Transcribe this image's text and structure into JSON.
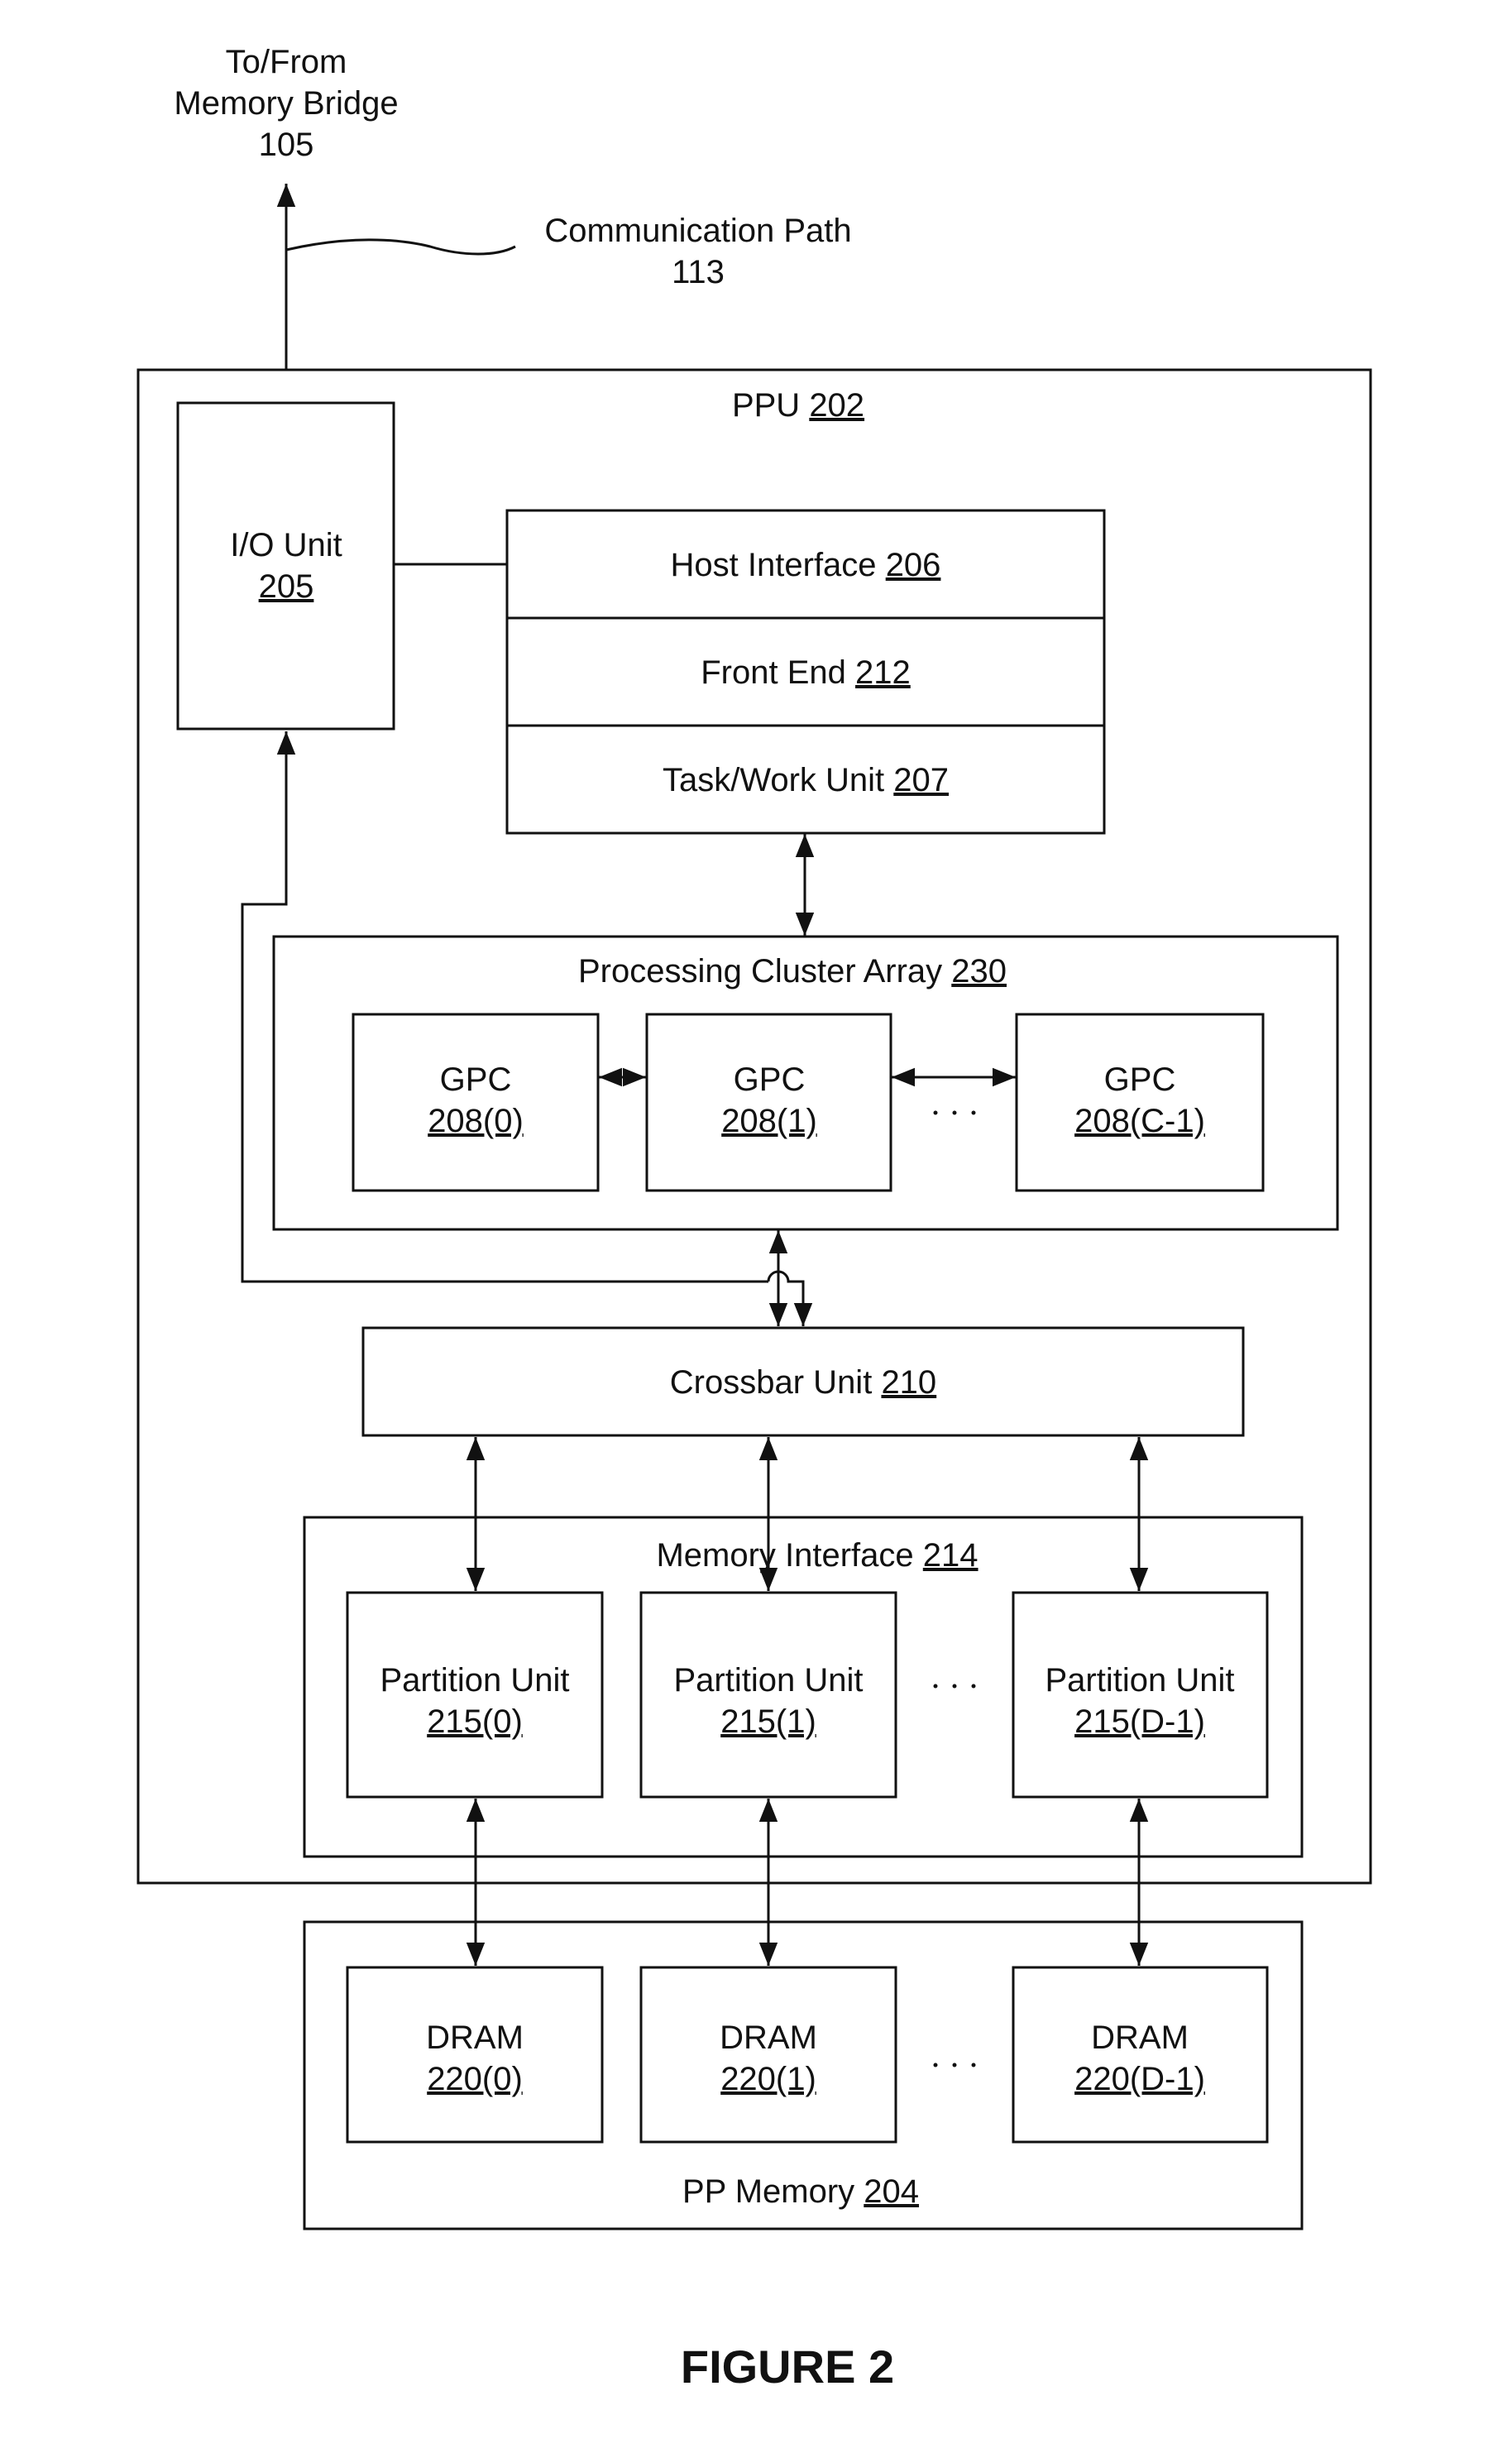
{
  "external": {
    "memory_bridge": {
      "line1": "To/From",
      "line2": "Memory Bridge",
      "ref": "105"
    },
    "communication_path": {
      "label": "Communication Path",
      "ref": "113"
    }
  },
  "ppu": {
    "label": "PPU",
    "ref": "202"
  },
  "io_unit": {
    "label": "I/O Unit",
    "ref": "205"
  },
  "host_stack": [
    {
      "label": "Host Interface",
      "ref": "206"
    },
    {
      "label": "Front End",
      "ref": "212"
    },
    {
      "label": "Task/Work Unit",
      "ref": "207"
    }
  ],
  "processing_cluster_array": {
    "label": "Processing Cluster Array",
    "ref": "230",
    "gpcs": [
      {
        "label": "GPC",
        "ref": "208(0)"
      },
      {
        "label": "GPC",
        "ref": "208(1)"
      },
      {
        "label": "GPC",
        "ref": "208(C-1)"
      }
    ],
    "ellipsis": "· · ·"
  },
  "crossbar": {
    "label": "Crossbar Unit",
    "ref": "210"
  },
  "memory_interface": {
    "label": "Memory Interface",
    "ref": "214",
    "partitions": [
      {
        "label": "Partition Unit",
        "ref": "215(0)"
      },
      {
        "label": "Partition Unit",
        "ref": "215(1)"
      },
      {
        "label": "Partition Unit",
        "ref": "215(D-1)"
      }
    ],
    "ellipsis": "· · ·"
  },
  "pp_memory": {
    "label": "PP Memory",
    "ref": "204",
    "drams": [
      {
        "label": "DRAM",
        "ref": "220(0)"
      },
      {
        "label": "DRAM",
        "ref": "220(1)"
      },
      {
        "label": "DRAM",
        "ref": "220(D-1)"
      }
    ],
    "ellipsis": "· · ·"
  },
  "figure_caption": "FIGURE 2"
}
